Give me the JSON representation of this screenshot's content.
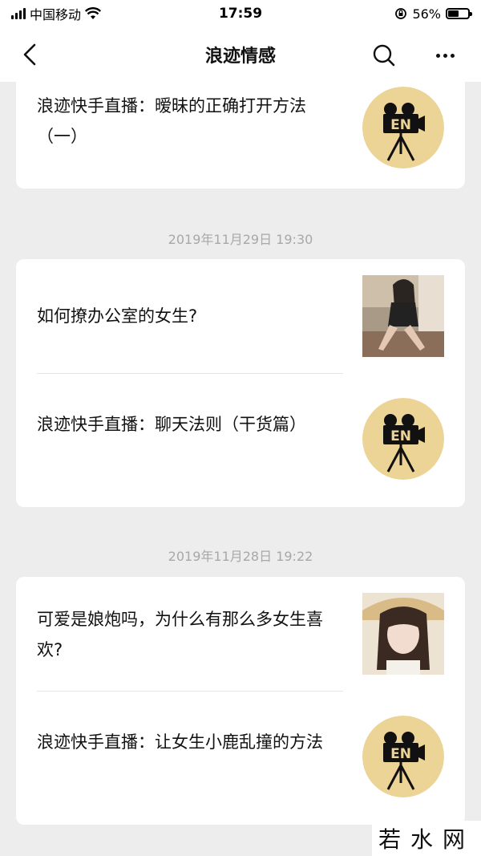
{
  "status_bar": {
    "carrier": "中国移动",
    "time": "17:59",
    "battery_percent": "56%",
    "battery_level": 0.56
  },
  "nav": {
    "title": "浪迹情感",
    "back_icon": "chevron-left-icon",
    "search_icon": "search-icon",
    "more_icon": "more-icon"
  },
  "feed": {
    "groups": [
      {
        "timestamp": "",
        "items": [
          {
            "title": "浪迹快手直播：暧昧的正确打开方法（一）",
            "thumb": "en-camera-logo"
          }
        ]
      },
      {
        "timestamp": "2019年11月29日 19:30",
        "items": [
          {
            "title": "如何撩办公室的女生?",
            "thumb": "photo-office-woman"
          },
          {
            "title": "浪迹快手直播：聊天法则（干货篇）",
            "thumb": "en-camera-logo"
          }
        ]
      },
      {
        "timestamp": "2019年11月28日 19:22",
        "items": [
          {
            "title": "可爱是娘炮吗，为什么有那么多女生喜欢?",
            "thumb": "photo-girl-hat"
          },
          {
            "title": "浪迹快手直播：让女生小鹿乱撞的方法",
            "thumb": "en-camera-logo"
          }
        ]
      }
    ]
  },
  "logo_text": "EN",
  "watermark": "若水网",
  "colors": {
    "background": "#ededed",
    "card": "#ffffff",
    "logo_bg": "#ebd496",
    "timestamp": "#a8a8a8"
  }
}
